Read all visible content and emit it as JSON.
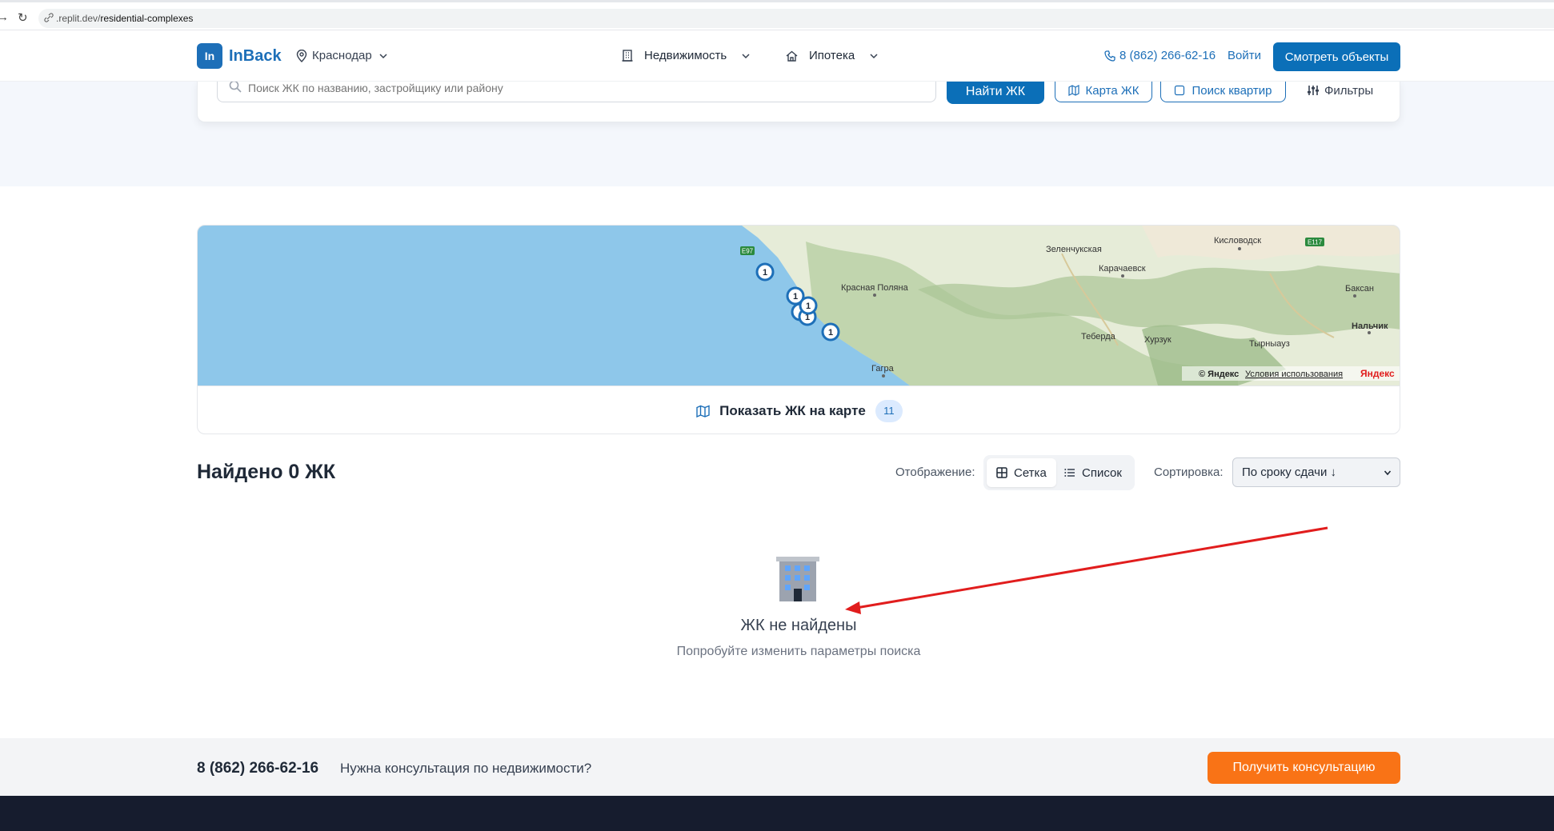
{
  "browser": {
    "url_prefix": ".replit.dev/",
    "url_path": "residential-complexes"
  },
  "header": {
    "logo_mark": "In",
    "logo_text": "InBack",
    "city": "Краснодар",
    "nav": [
      {
        "label": "Недвижимость",
        "icon": "building-icon"
      },
      {
        "label": "Ипотека",
        "icon": "home-icon"
      }
    ],
    "phone": "8 (862) 266-62-16",
    "login": "Войти",
    "cta": "Смотреть объекты"
  },
  "search": {
    "placeholder": "Поиск ЖК по названию, застройщику или району",
    "find_button": "Найти ЖК",
    "map_button": "Карта ЖК",
    "apartments_button": "Поиск квартир",
    "filters_button": "Фильтры"
  },
  "map": {
    "labels": [
      "Зеленчукская",
      "Кисловодск",
      "Карачаевск",
      "Красная Поляна",
      "Баксан",
      "Нальчик",
      "Теберда",
      "Хурзук",
      "Тырныауз",
      "Гагра"
    ],
    "road_labels": [
      "E97",
      "E117"
    ],
    "cluster_count": "1",
    "attribution": "© Яндекс",
    "terms": "Условия использования",
    "brand": "Яндекс",
    "show_on_map": "Показать ЖК на карте",
    "count": "11"
  },
  "results": {
    "title": "Найдено 0 ЖК",
    "view_label": "Отображение:",
    "view_grid": "Сетка",
    "view_list": "Список",
    "sort_label": "Сортировка:",
    "sort_value": "По сроку сдачи ↓"
  },
  "empty": {
    "title": "ЖК не найдены",
    "subtitle": "Попробуйте изменить параметры поиска"
  },
  "cta_band": {
    "phone": "8 (862) 266-62-16",
    "text": "Нужна консультация по недвижимости?",
    "button": "Получить консультацию"
  },
  "colors": {
    "primary": "#0b6fb8",
    "accent_orange": "#f97316",
    "annotation_red": "#e11d1d",
    "sea": "#8ec7ea",
    "land": "#e6ecd8"
  }
}
